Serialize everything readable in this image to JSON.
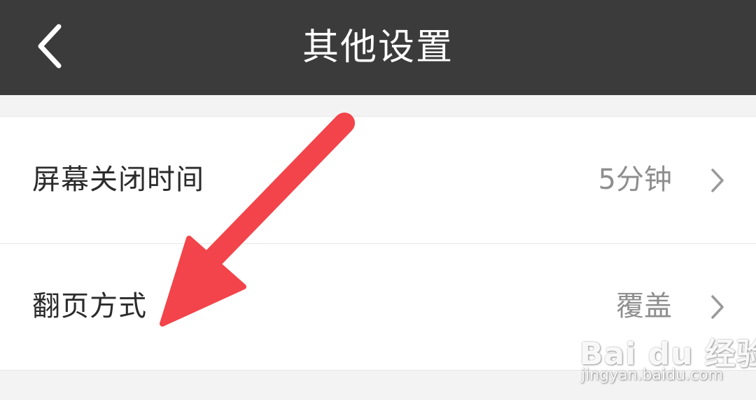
{
  "header": {
    "title": "其他设置",
    "back_icon": "chevron-left-icon"
  },
  "settings": {
    "items": [
      {
        "label": "屏幕关闭时间",
        "value": "5分钟",
        "icon": "chevron-right-icon"
      },
      {
        "label": "翻页方式",
        "value": "覆盖",
        "icon": "chevron-right-icon"
      }
    ]
  },
  "annotation": {
    "icon": "arrow-annotation-icon",
    "color": "#f2444a"
  },
  "watermark": {
    "brand": "Bai du 经验",
    "url": "jingyan.baidu.com"
  },
  "colors": {
    "topbar": "#3b3b3b",
    "background": "#f3f3f3",
    "row_background": "#ffffff",
    "label_text": "#2b2b2b",
    "value_text": "#8e8e8e"
  }
}
